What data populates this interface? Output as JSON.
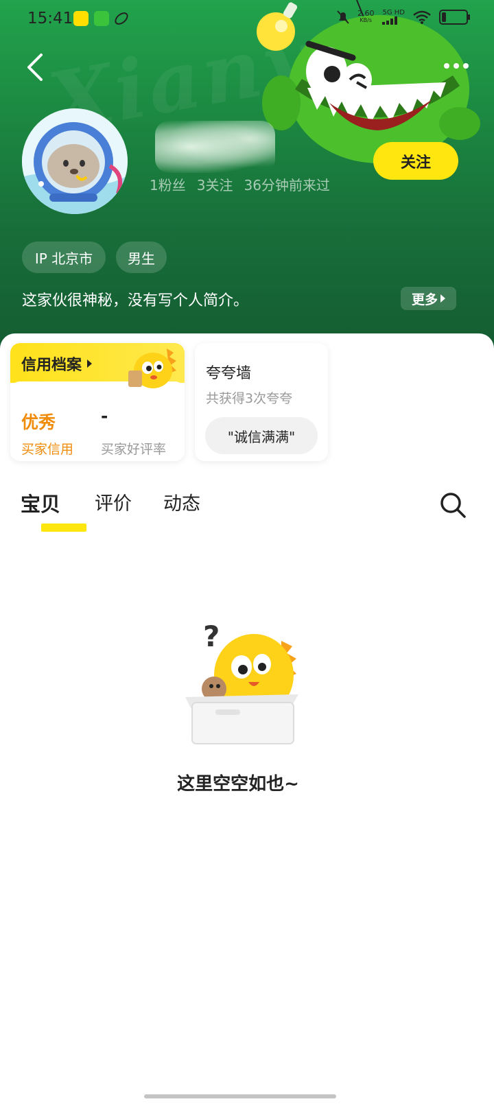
{
  "status_bar": {
    "time": "15:41",
    "network_speed": "2.60",
    "network_unit": "KB/s",
    "network_type": "5G HD",
    "battery_level": 0.18
  },
  "header": {
    "watermark": "Xianyu",
    "stats": {
      "fans": "1粉丝",
      "follows": "3关注",
      "last_seen": "36分钟前来过"
    },
    "follow_label": "关注",
    "tags": {
      "ip": "IP 北京市",
      "gender": "男生"
    },
    "bio": "这家伙很神秘，没有写个人简介。",
    "bio_more": "更多"
  },
  "credit": {
    "title": "信用档案",
    "credit_value": "优秀",
    "credit_label": "买家信用",
    "rate_value": "-",
    "rate_label": "买家好评率"
  },
  "praise": {
    "title": "夸夸墙",
    "subtitle": "共获得3次夸夸",
    "chip": "\"诚信满满\""
  },
  "tabs": [
    {
      "label": "宝贝",
      "active": true
    },
    {
      "label": "评价",
      "active": false
    },
    {
      "label": "动态",
      "active": false
    }
  ],
  "empty": {
    "text": "这里空空如也~"
  },
  "colors": {
    "brand_yellow": "#ffe60f",
    "header_green": "#1c8a42",
    "credit_orange": "#f08c0c"
  }
}
